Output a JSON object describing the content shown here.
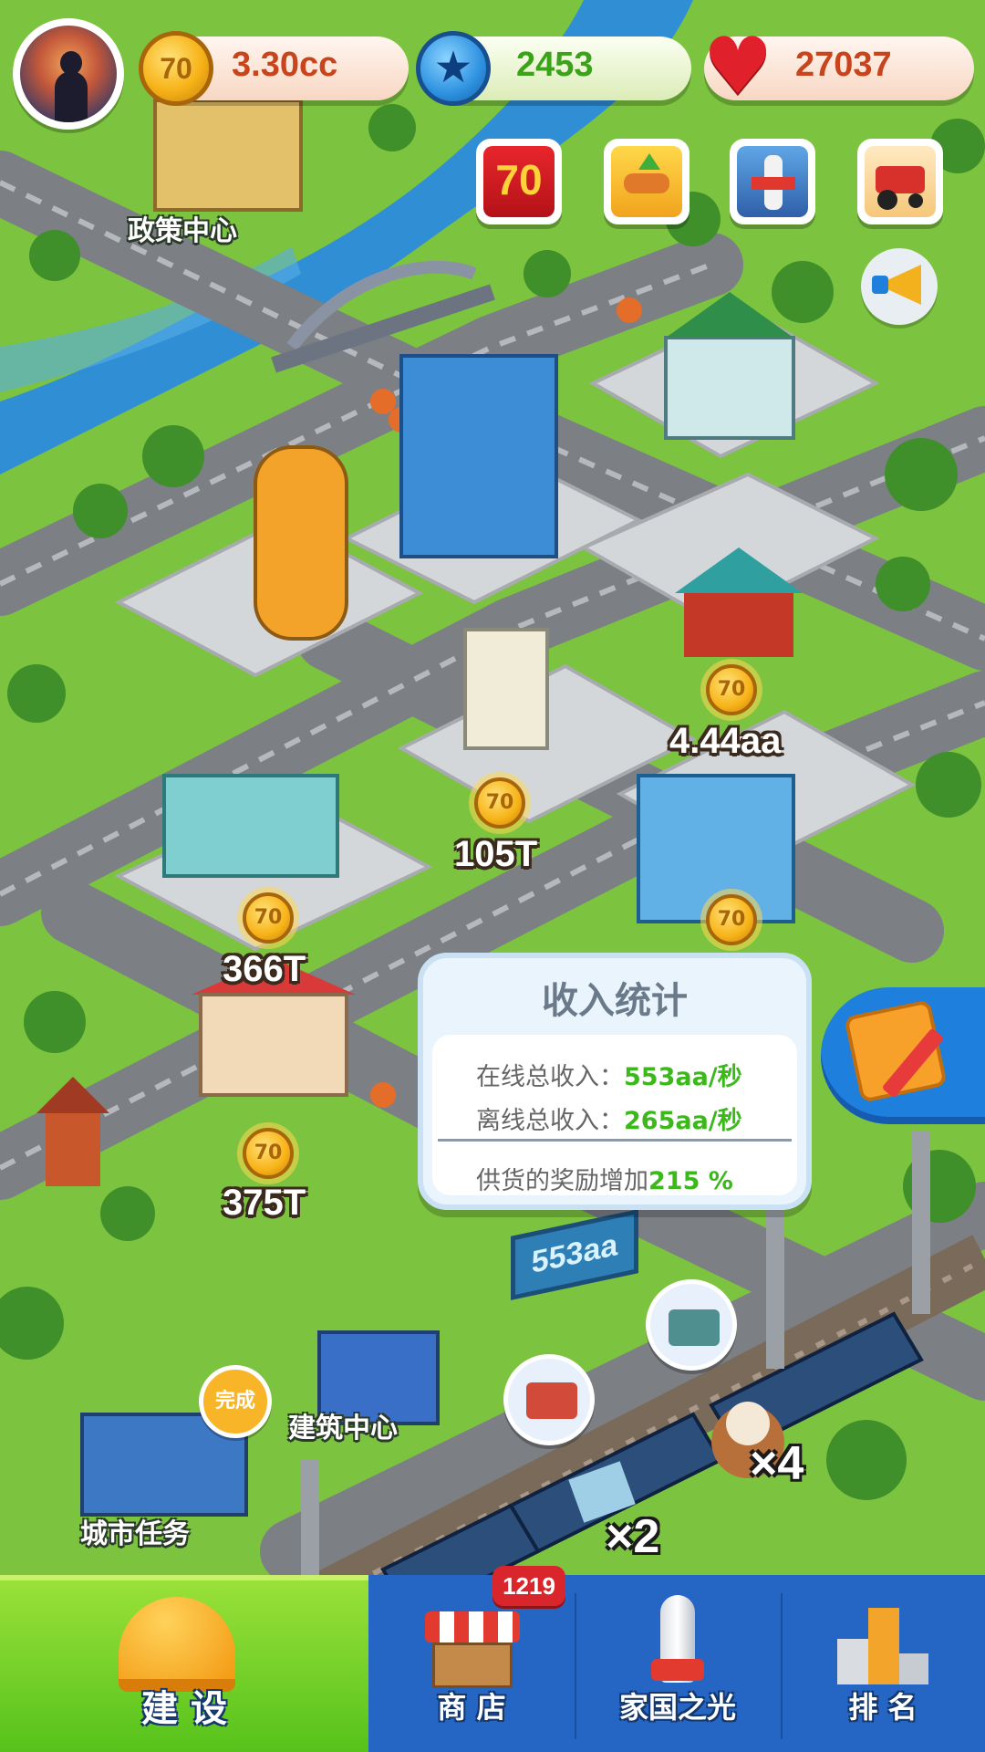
{
  "resources": {
    "coins": {
      "value": "3.30cc",
      "icon": "coin-70-icon",
      "color": "#c8441d"
    },
    "gems": {
      "value": "2453",
      "icon": "blue-star-icon",
      "color": "#3aa31a"
    },
    "hearts": {
      "value": "27037",
      "icon": "heart-icon",
      "color": "#c8441d"
    }
  },
  "coin_glyph": "70",
  "events": [
    {
      "name": "event-70-anniversary-icon"
    },
    {
      "name": "event-handshake-icon"
    },
    {
      "name": "event-landmark-icon"
    },
    {
      "name": "event-tractor-icon"
    }
  ],
  "map": {
    "policy_center": "政策中心",
    "building_center": "建筑中心",
    "city_tasks": "城市任务",
    "task_status": "完成",
    "incomes": {
      "teahouse": "4.44aa",
      "tv_station": "105T",
      "trade_mall": "366T",
      "house": "375T"
    },
    "billboard": "553aa",
    "train_cargo_1": "×4",
    "train_cargo_2": "×2"
  },
  "income_panel": {
    "title": "收入统计",
    "online_label": "在线总收入：",
    "online_value": "553aa/秒",
    "offline_label": "离线总收入：",
    "offline_value": "265aa/秒",
    "bonus_label": "供货的奖励增加",
    "bonus_value": "215 %"
  },
  "nav": {
    "build": "建 设",
    "shop": "商 店",
    "shop_badge": "1219",
    "national_light": "家国之光",
    "ranking": "排 名"
  }
}
